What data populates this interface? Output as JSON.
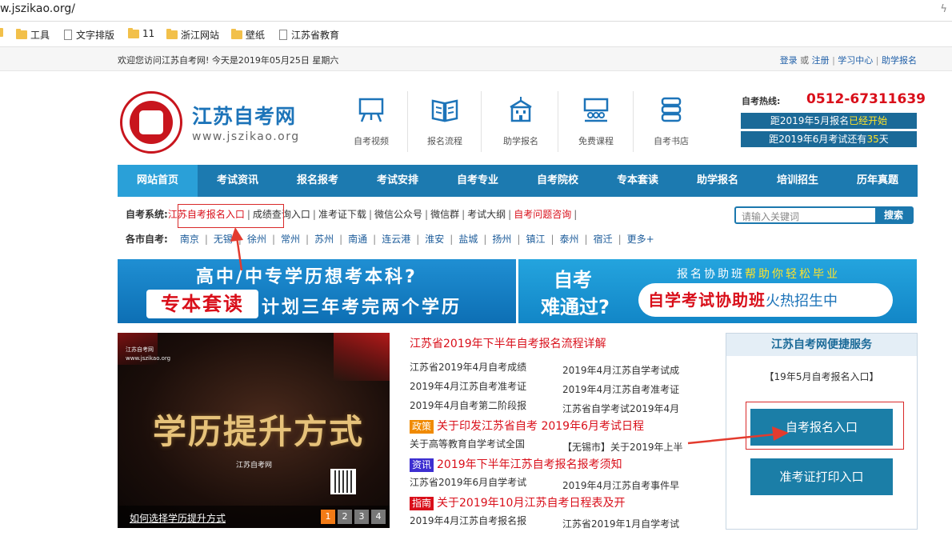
{
  "browser": {
    "url": "w.jszikao.org/",
    "bookmarks": [
      {
        "label": "",
        "kind": "folder-partial"
      },
      {
        "label": "工具",
        "kind": "folder"
      },
      {
        "label": "文字排版",
        "kind": "page"
      },
      {
        "label": "11",
        "kind": "folder"
      },
      {
        "label": "浙江网站",
        "kind": "folder"
      },
      {
        "label": "壁纸",
        "kind": "folder"
      },
      {
        "label": "江苏省教育",
        "kind": "page"
      }
    ]
  },
  "topbar": {
    "welcome": "欢迎您访问江苏自考网! 今天是2019年05月25日 星期六",
    "links": [
      "登录",
      "注册",
      "学习中心",
      "助学报名"
    ],
    "or_text": "或"
  },
  "header": {
    "logo_title": "江苏自考网",
    "logo_url": "www.jszikao.org",
    "quick_items": [
      {
        "label": "自考视频",
        "icon": "blackboard-icon"
      },
      {
        "label": "报名流程",
        "icon": "open-book-icon"
      },
      {
        "label": "助学报名",
        "icon": "school-building-icon"
      },
      {
        "label": "免费课程",
        "icon": "classroom-icon"
      },
      {
        "label": "自考书店",
        "icon": "bookshelf-icon"
      }
    ],
    "hotline_label": "自考热线:",
    "hotline_number": "0512-67311639",
    "notice1_prefix": "距2019年5月报名",
    "notice1_highlight": "已经开始",
    "notice2_prefix": "距2019年6月考试还有",
    "notice2_highlight": "35",
    "notice2_suffix": "天"
  },
  "nav": [
    "网站首页",
    "考试资讯",
    "报名报考",
    "考试安排",
    "自考专业",
    "自考院校",
    "专本套读",
    "助学报名",
    "培训招生",
    "历年真题"
  ],
  "system_row": {
    "lead": "自考系统:",
    "items": [
      "江苏自考报名入口",
      "成绩查询入口",
      "准考证下载",
      "微信公众号",
      "微信群",
      "考试大纲",
      "自考问题咨询"
    ]
  },
  "city_row": {
    "lead": "各市自考:",
    "cities": [
      "南京",
      "无锡",
      "徐州",
      "常州",
      "苏州",
      "南通",
      "连云港",
      "淮安",
      "盐城",
      "扬州",
      "镇江",
      "泰州",
      "宿迁",
      "更多+"
    ]
  },
  "search": {
    "placeholder": "请输入关键词",
    "button": "搜索"
  },
  "banner1": {
    "line1": "高中/中专学历想考本科?",
    "box": "专本套读",
    "line2": "计划三年考完两个学历"
  },
  "banner2": {
    "z1": "自考",
    "z2": "难通过?",
    "top_a": "报名协助班",
    "top_b": "帮助你轻松毕业",
    "pill_a": "自学考试协助班",
    "pill_b": "火热招生中"
  },
  "slide": {
    "brand1": "江苏自考网",
    "brand2": "www.jszikao.org",
    "calligraphy": "学历提升方式",
    "sub": "江苏自考网",
    "caption": "如何选择学历提升方式",
    "pages": [
      "1",
      "2",
      "3",
      "4"
    ]
  },
  "news": {
    "headline": "江苏省2019年下半年自考报名流程详解",
    "rows": [
      [
        "江苏省2019年4月自考成绩",
        "2019年4月江苏自学考试成"
      ],
      [
        "2019年4月江苏自考准考证",
        "2019年4月江苏自考准考证"
      ],
      [
        "2019年4月自考第二阶段报",
        "江苏省自学考试2019年4月"
      ]
    ],
    "tag1": "政策",
    "title1": "关于印发江苏省自考 2019年6月考试日程",
    "row4": [
      "关于高等教育自学考试全国",
      "【无锡市】关于2019年上半"
    ],
    "tag2": "资讯",
    "title2": "2019年下半年江苏自考报名报考须知",
    "row5": [
      "江苏省2019年6月自学考试",
      "2019年4月江苏自考事件早"
    ],
    "tag3": "指南",
    "title3": "关于2019年10月江苏自考日程表及开",
    "row6": [
      "2019年4月江苏自考报名报",
      "江苏省2019年1月自学考试"
    ]
  },
  "service": {
    "title": "江苏自考网便捷服务",
    "note": "【19年5月自考报名入口】",
    "btn1": "自考报名入口",
    "btn2": "准考证打印入口"
  },
  "colors": {
    "brand_blue": "#1c7ab0",
    "accent_red": "#d90f1a",
    "highlight_yellow": "#ffe32a",
    "policy_tag": "#f08a00",
    "news_tag": "#3d2fd1",
    "guide_tag": "#d90f1a"
  }
}
